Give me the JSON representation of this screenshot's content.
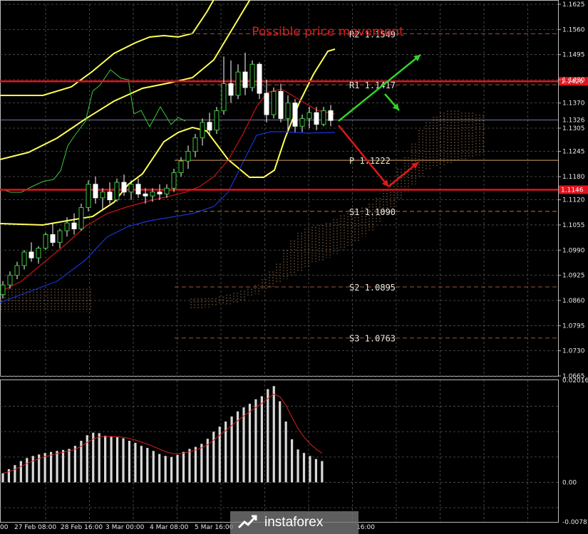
{
  "chart_data": [
    {
      "type": "candlestick",
      "title": "Possible price movement",
      "ylim": [
        1.0665,
        1.1625
      ],
      "y_ticks": [
        "1.1625",
        "1.1560",
        "1.1495",
        "1.1430",
        "1.1370",
        "1.1305",
        "1.1245",
        "1.1180",
        "1.1120",
        "1.1055",
        "1.0990",
        "1.0925",
        "1.0860",
        "1.0795",
        "1.0730",
        "1.0665"
      ],
      "x_ticks": [
        "00",
        "27 Feb 08:00",
        "28 Feb 16:00",
        "3 Mar 00:00",
        "4 Mar 08:00",
        "5 Mar 16:00",
        "16:00"
      ],
      "current_price": "1.1326",
      "levels": [
        {
          "name": "R2",
          "label": "R2",
          "value": "1.1549",
          "price": 1.1549
        },
        {
          "name": "R1",
          "label": "R1",
          "value": "1.1417",
          "price": 1.1417
        },
        {
          "name": "P",
          "label": "P",
          "value": "1.1222",
          "price": 1.1222
        },
        {
          "name": "S1",
          "label": "S1",
          "value": "1.1090",
          "price": 1.109
        },
        {
          "name": "S2",
          "label": "S2",
          "value": "1.0895",
          "price": 1.0895
        },
        {
          "name": "S3",
          "label": "S3",
          "value": "1.0763",
          "price": 1.0763
        }
      ],
      "resistance_line": {
        "price": 1.1426,
        "tag": "1.1426",
        "color": "#e0141e"
      },
      "support_line": {
        "price": 1.1146,
        "tag": "1.1146",
        "color": "#e0141e"
      },
      "candles": [
        [
          1.0875,
          1.091,
          1.0865,
          1.09
        ],
        [
          1.09,
          1.0935,
          1.089,
          1.0925
        ],
        [
          1.0925,
          1.096,
          1.0915,
          1.095
        ],
        [
          1.095,
          1.099,
          1.094,
          1.0985
        ],
        [
          1.0985,
          1.101,
          1.096,
          1.097
        ],
        [
          1.097,
          1.1,
          1.0955,
          1.0995
        ],
        [
          1.0995,
          1.1035,
          1.099,
          1.103
        ],
        [
          1.103,
          1.106,
          1.1,
          1.101
        ],
        [
          1.101,
          1.1045,
          1.0995,
          1.104
        ],
        [
          1.104,
          1.1075,
          1.1025,
          1.106
        ],
        [
          1.106,
          1.1085,
          1.103,
          1.1045
        ],
        [
          1.1045,
          1.111,
          1.104,
          1.11
        ],
        [
          1.11,
          1.117,
          1.109,
          1.116
        ],
        [
          1.116,
          1.118,
          1.111,
          1.1125
        ],
        [
          1.1125,
          1.115,
          1.1095,
          1.114
        ],
        [
          1.114,
          1.1165,
          1.111,
          1.112
        ],
        [
          1.112,
          1.1175,
          1.1115,
          1.1165
        ],
        [
          1.1165,
          1.1185,
          1.113,
          1.114
        ],
        [
          1.114,
          1.117,
          1.112,
          1.116
        ],
        [
          1.116,
          1.1175,
          1.1125,
          1.1135
        ],
        [
          1.1135,
          1.115,
          1.111,
          1.113
        ],
        [
          1.113,
          1.115,
          1.1115,
          1.114
        ],
        [
          1.114,
          1.116,
          1.112,
          1.1135
        ],
        [
          1.1135,
          1.116,
          1.1125,
          1.115
        ],
        [
          1.115,
          1.12,
          1.114,
          1.119
        ],
        [
          1.119,
          1.123,
          1.118,
          1.122
        ],
        [
          1.122,
          1.126,
          1.12,
          1.1245
        ],
        [
          1.1245,
          1.129,
          1.123,
          1.128
        ],
        [
          1.128,
          1.133,
          1.126,
          1.132
        ],
        [
          1.132,
          1.1345,
          1.1285,
          1.13
        ],
        [
          1.13,
          1.136,
          1.129,
          1.135
        ],
        [
          1.135,
          1.149,
          1.134,
          1.142
        ],
        [
          1.142,
          1.148,
          1.137,
          1.139
        ],
        [
          1.139,
          1.147,
          1.138,
          1.145
        ],
        [
          1.145,
          1.15,
          1.139,
          1.141
        ],
        [
          1.141,
          1.148,
          1.14,
          1.147
        ],
        [
          1.147,
          1.1475,
          1.138,
          1.1395
        ],
        [
          1.1395,
          1.143,
          1.132,
          1.134
        ],
        [
          1.134,
          1.141,
          1.133,
          1.14
        ],
        [
          1.14,
          1.142,
          1.132,
          1.133
        ],
        [
          1.133,
          1.139,
          1.13,
          1.137
        ],
        [
          1.137,
          1.138,
          1.1295,
          1.131
        ],
        [
          1.131,
          1.134,
          1.1295,
          1.133
        ],
        [
          1.133,
          1.136,
          1.1305,
          1.1345
        ],
        [
          1.1345,
          1.136,
          1.13,
          1.1315
        ],
        [
          1.1315,
          1.136,
          1.131,
          1.135
        ],
        [
          1.135,
          1.1365,
          1.131,
          1.1325
        ]
      ],
      "osc_ylim": [
        -0.00781,
        0.02016
      ],
      "osc_ticks": [
        "0.02016",
        "0.00",
        "-0.00781"
      ],
      "oscillator": [
        0.0018,
        0.0026,
        0.0034,
        0.0042,
        0.0048,
        0.0052,
        0.0055,
        0.0058,
        0.006,
        0.0062,
        0.0064,
        0.0066,
        0.0072,
        0.0082,
        0.0093,
        0.0098,
        0.0097,
        0.0092,
        0.0091,
        0.0089,
        0.0087,
        0.0082,
        0.0078,
        0.0072,
        0.0068,
        0.0062,
        0.0056,
        0.0052,
        0.005,
        0.0054,
        0.006,
        0.0066,
        0.007,
        0.0076,
        0.0086,
        0.01,
        0.011,
        0.012,
        0.013,
        0.014,
        0.0148,
        0.0155,
        0.0164,
        0.017,
        0.0184,
        0.019,
        0.016,
        0.012,
        0.0085,
        0.0065,
        0.0058,
        0.0052,
        0.0046,
        0.0042
      ],
      "price_axis_color": "#c8c8c8",
      "colors": {
        "bull": "#ffffff",
        "bear": "#ffffff",
        "tenkan": "#c81414",
        "kijun": "#1a33d6",
        "bollinger": "#ffff55",
        "lime_line": "#3cc83c",
        "cloud": "#e8a86a",
        "arrow_green": "#34d12a",
        "arrow_red": "#e01818",
        "osc_bar": "#d8d8d8",
        "osc_signal": "#d81e1e"
      }
    }
  ],
  "watermark": {
    "brand": "instaforex"
  }
}
